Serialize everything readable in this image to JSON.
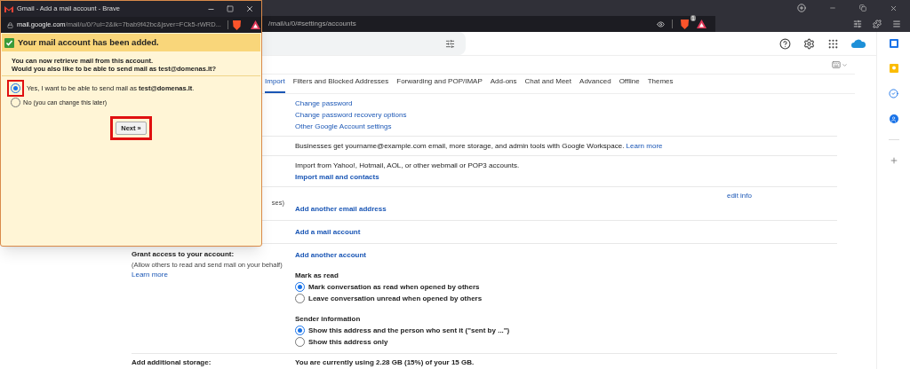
{
  "browser": {
    "url_tail": "/mail/u/0/#settings/accounts",
    "shield_count": "1"
  },
  "settings_tabs": [
    {
      "label": "Import",
      "selected": true
    },
    {
      "label": "Filters and Blocked Addresses",
      "selected": false
    },
    {
      "label": "Forwarding and POP/IMAP",
      "selected": false
    },
    {
      "label": "Add-ons",
      "selected": false
    },
    {
      "label": "Chat and Meet",
      "selected": false
    },
    {
      "label": "Advanced",
      "selected": false
    },
    {
      "label": "Offline",
      "selected": false
    },
    {
      "label": "Themes",
      "selected": false
    }
  ],
  "sections": [
    {
      "lines": [
        {
          "kind": "link",
          "text": "Change password"
        },
        {
          "kind": "link",
          "text": "Change password recovery options"
        },
        {
          "kind": "link",
          "text": "Other Google Account settings"
        }
      ]
    },
    {
      "lines": [
        {
          "kind": "text",
          "text": "Businesses get yourname@example.com email, more storage, and admin tools with Google Workspace.",
          "link": "Learn more"
        }
      ]
    },
    {
      "lines": [
        {
          "kind": "text",
          "text": "Import from Yahoo!, Hotmail, AOL, or other webmail or POP3 accounts."
        },
        {
          "kind": "action",
          "text": "Import mail and contacts"
        }
      ]
    },
    {
      "label": [
        {
          "kind": "note",
          "text": "ses)"
        }
      ],
      "side": "edit info",
      "lines": [
        {
          "kind": "action",
          "text": "Add another email address"
        }
      ]
    },
    {
      "lines": [
        {
          "kind": "action",
          "text": "Add a mail account"
        }
      ]
    },
    {
      "label": [
        {
          "kind": "heading",
          "text": "Grant access to your account:"
        },
        {
          "kind": "note",
          "text": "(Allow others to read and send mail on your behalf)"
        },
        {
          "kind": "link",
          "text": "Learn more"
        }
      ],
      "lines": [
        {
          "kind": "action",
          "text": "Add another account"
        },
        {
          "kind": "group",
          "title": "Mark as read",
          "options": [
            {
              "label": "Mark conversation as read when opened by others",
              "selected": true
            },
            {
              "label": "Leave conversation unread when opened by others",
              "selected": false
            }
          ]
        },
        {
          "kind": "group",
          "title": "Sender information",
          "options": [
            {
              "label": "Show this address and the person who sent it (\"sent by ...\")",
              "selected": true
            },
            {
              "label": "Show this address only",
              "selected": false
            }
          ]
        }
      ]
    },
    {
      "label": [
        {
          "kind": "heading",
          "text": "Add additional storage:"
        }
      ],
      "lines": [
        {
          "kind": "strong",
          "text": "You are currently using 2.28 GB (15%) of your 15 GB."
        }
      ]
    }
  ],
  "popup": {
    "title": "Gmail - Add a mail account - Brave",
    "url_host": "mail.google.com",
    "url_path": "/mail/u/0/?ui=2&ik=7bab9f42bc&jsver=FCk5-rWRD...",
    "banner": "Your mail account has been added.",
    "message": [
      "You can now retrieve mail from this account.",
      "Would you also like to be able to send mail as test@domenas.lt?"
    ],
    "options": [
      {
        "label": "Yes, I want to be able to send mail as **test@domenas.lt**.",
        "selected": true,
        "highlighted": true
      },
      {
        "label": "No",
        "hint": "(you can change this later)",
        "selected": false,
        "highlighted": false
      }
    ],
    "next_button": "Next »",
    "next_highlighted": true
  }
}
